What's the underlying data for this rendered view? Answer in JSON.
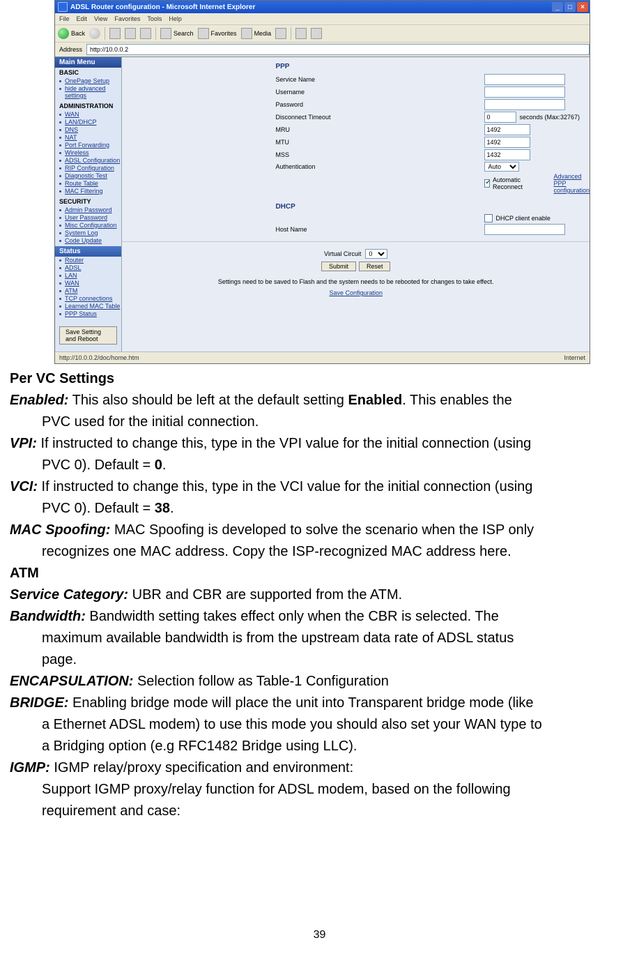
{
  "screenshot": {
    "titlebar": "ADSL Router configuration - Microsoft Internet Explorer",
    "win_min": "_",
    "win_max": "□",
    "win_close": "×",
    "menus": {
      "file": "File",
      "edit": "Edit",
      "view": "View",
      "favorites": "Favorites",
      "tools": "Tools",
      "help": "Help"
    },
    "toolbar": {
      "back": "Back",
      "search": "Search",
      "favorites": "Favorites",
      "media": "Media"
    },
    "address_label": "Address",
    "address_value": "http://10.0.0.2",
    "sidebar": {
      "main_menu": "Main Menu",
      "basic": "BASIC",
      "basic_items": [
        "OnePage Setup",
        "hide advanced settings"
      ],
      "admin": "ADMINISTRATION",
      "admin_items": [
        "WAN",
        "LAN/DHCP",
        "DNS",
        "NAT",
        "Port Forwarding",
        "Wireless",
        "ADSL Configuration",
        "RIP Configuration",
        "Diagnostic Test",
        "Route Table",
        "MAC Filtering"
      ],
      "security": "SECURITY",
      "security_items": [
        "Admin Password",
        "User Password",
        "Misc Configuration",
        "System Log",
        "Code Update"
      ],
      "status": "Status",
      "status_items": [
        "Router",
        "ADSL",
        "LAN",
        "WAN",
        "ATM",
        "TCP connections",
        "Learned MAC Table",
        "PPP Status"
      ],
      "save_reboot": "Save Setting and Reboot"
    },
    "ppp": {
      "title": "PPP",
      "service_name": "Service Name",
      "username": "Username",
      "password": "Password",
      "disconnect_timeout": "Disconnect Timeout",
      "disconnect_val": "0",
      "disconnect_hint": "seconds (Max:32767)",
      "mru": "MRU",
      "mru_val": "1492",
      "mtu": "MTU",
      "mtu_val": "1492",
      "mss": "MSS",
      "mss_val": "1432",
      "auth": "Authentication",
      "auth_val": "Auto",
      "auto_reconnect": "Automatic Reconnect",
      "adv_link": "Advanced PPP configuration"
    },
    "dhcp": {
      "title": "DHCP",
      "client_enable": "DHCP client enable",
      "host_name": "Host Name"
    },
    "vc": {
      "label": "Virtual Circuit",
      "value": "0"
    },
    "buttons": {
      "submit": "Submit",
      "reset": "Reset"
    },
    "flash_note": "Settings need to be saved to Flash and the system needs to be rebooted for changes to take effect.",
    "save_conf": "Save Configuration",
    "status_left": "http://10.0.0.2/doc/home.htm",
    "status_right": "Internet"
  },
  "doc": {
    "h_per_vc": "Per VC Settings",
    "enabled_term": "Enabled:",
    "enabled_l1a": " This also should be left at the default setting ",
    "enabled_bold": "Enabled",
    "enabled_l1b": ". This enables the",
    "enabled_l2": "PVC used for the initial connection.",
    "vpi_term": "VPI:",
    "vpi_l1": " If instructed to change this, type in the VPI value for the initial connection (using",
    "vpi_l2a": "PVC 0). Default = ",
    "vpi_bold": "0",
    "vpi_l2b": ".",
    "vci_term": "VCI:",
    "vci_l1": " If instructed to change this, type in the VCI value for the initial connection (using",
    "vci_l2a": "PVC 0). Default = ",
    "vci_bold": "38",
    "vci_l2b": ".",
    "mac_term": "MAC Spoofing:",
    "mac_l1": " MAC Spoofing is developed to solve the scenario when the ISP only",
    "mac_l2": "recognizes one MAC address. Copy the ISP-recognized MAC address here.",
    "h_atm": "ATM",
    "svc_term": "Service Category:",
    "svc_l1": " UBR and CBR are supported from the ATM.",
    "bw_term": "Bandwidth:",
    "bw_l1": " Bandwidth setting takes effect only when the CBR is selected. The",
    "bw_l2": "maximum available bandwidth is from the upstream data rate of ADSL status",
    "bw_l3": "page.",
    "enc_term": "ENCAPSULATION:",
    "enc_l1": " Selection follow as Table-1 Configuration",
    "br_term": "BRIDGE:",
    "br_l1": " Enabling bridge mode will place the unit into Transparent bridge mode (like",
    "br_l2": "a Ethernet ADSL modem) to use this mode you should also set your WAN type to",
    "br_l3": "a Bridging option (e.g RFC1482 Bridge using LLC).",
    "igmp_term": "IGMP:",
    "igmp_l1": " IGMP relay/proxy specification and environment:",
    "igmp_l2": "Support IGMP proxy/relay function for ADSL modem, based on the following",
    "igmp_l3": "requirement and case:",
    "page_number": "39"
  }
}
